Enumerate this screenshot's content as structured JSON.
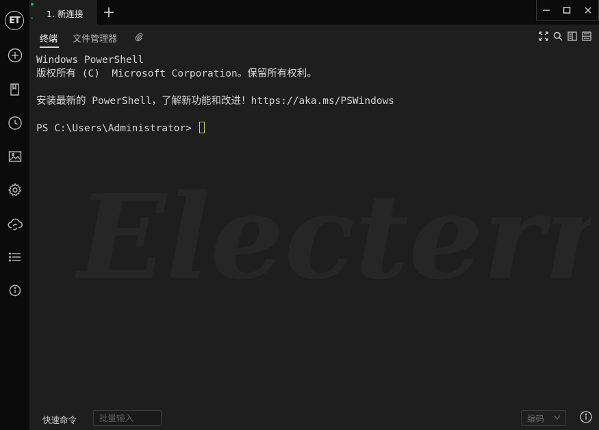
{
  "app": {
    "logo_text": "ET"
  },
  "tabs": [
    {
      "label": "1. 新连接"
    }
  ],
  "subtabs": {
    "terminal": "终端",
    "file_manager": "文件管理器"
  },
  "terminal": {
    "lines": [
      "Windows PowerShell",
      "版权所有 (C)  Microsoft Corporation。保留所有权利。",
      "",
      "安装最新的 PowerShell，了解新功能和改进！https://aka.ms/PSWindows",
      "",
      "PS C:\\Users\\Administrator> "
    ],
    "watermark": "Electerm",
    "cursor_color": "#c9d46b"
  },
  "bottom": {
    "quick_command_label": "快速命令",
    "batch_input_placeholder": "批量输入",
    "encoding_label": "编码"
  },
  "icons": {
    "sidebar": [
      "add-circle-icon",
      "bookmark-icon",
      "history-clock-icon",
      "image-icon",
      "settings-gear-icon",
      "cloud-sync-icon",
      "list-icon",
      "info-icon"
    ],
    "toolbar": [
      "fullscreen-icon",
      "search-icon",
      "split-vertical-icon",
      "split-horizontal-icon"
    ],
    "attach": "paperclip-icon"
  },
  "colors": {
    "accent_green": "#16c05a",
    "background": "#1e1e1e",
    "sidebar": "#0b0b0b"
  }
}
